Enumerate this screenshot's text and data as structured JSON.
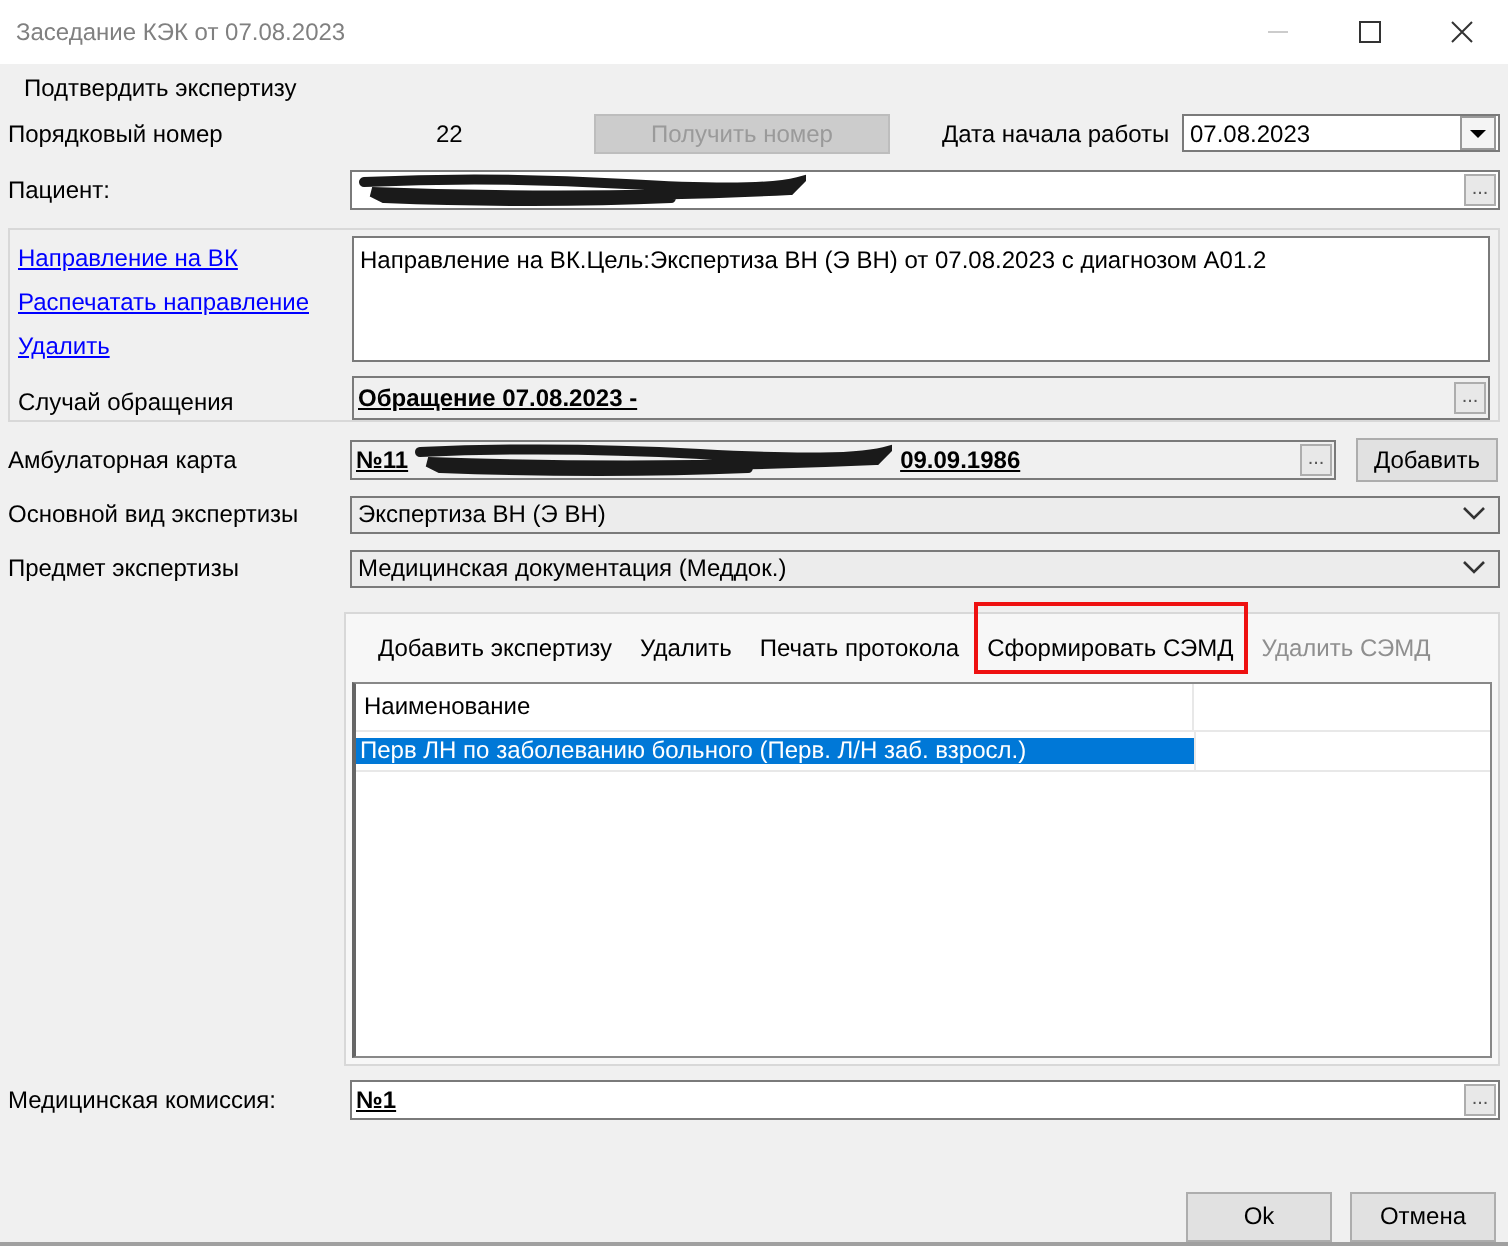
{
  "window": {
    "title": "Заседание КЭК от 07.08.2023"
  },
  "menu": [
    "Подтвердить экспертизу"
  ],
  "order": {
    "label": "Порядковый номер",
    "value": "22",
    "button": {
      "label": "Получить номер",
      "disabled": true
    }
  },
  "start_date": {
    "label": "Дата начала работы",
    "value": "07.08.2023"
  },
  "patient": {
    "label": "Пациент:",
    "redacted": true,
    "browse": "..."
  },
  "referral": {
    "links": [
      "Направление на ВК",
      "Распечатать направление",
      "Удалить"
    ],
    "text": "Направление на ВК.Цель:Экспертиза ВН (Э ВН) от 07.08.2023 с диагнозом A01.2",
    "case": {
      "label": "Случай обращения",
      "value": "Обращение 07.08.2023 -",
      "browse": "..."
    }
  },
  "card": {
    "label": "Амбулаторная карта",
    "value_start": "№11",
    "redacted": true,
    "value_end": "09.09.1986",
    "browse": "...",
    "button": "Добавить"
  },
  "expertise_type": {
    "label": "Основной вид экспертизы",
    "value": "Экспертиза ВН (Э ВН)"
  },
  "subject": {
    "label": "Предмет экспертизы",
    "value": "Медицинская документация (Меддок.)"
  },
  "toolbar": [
    {
      "label": "Добавить экспертизу",
      "disabled": false,
      "highlighted": false
    },
    {
      "label": "Удалить",
      "disabled": false,
      "highlighted": false
    },
    {
      "label": "Печать протокола",
      "disabled": false,
      "highlighted": false
    },
    {
      "label": "Сформировать СЭМД",
      "disabled": false,
      "highlighted": true
    },
    {
      "label": "Удалить СЭМД",
      "disabled": true,
      "highlighted": false
    }
  ],
  "grid": {
    "columns": [
      "Наименование"
    ],
    "rows": [
      {
        "cells": [
          "Перв ЛН по заболеванию больного (Перв. Л/Н заб. взросл.)"
        ],
        "selected": true
      }
    ]
  },
  "commission": {
    "label": "Медицинская комиссия:",
    "value": "№1",
    "browse": "..."
  },
  "buttons": [
    "Ok",
    "Отмена"
  ]
}
